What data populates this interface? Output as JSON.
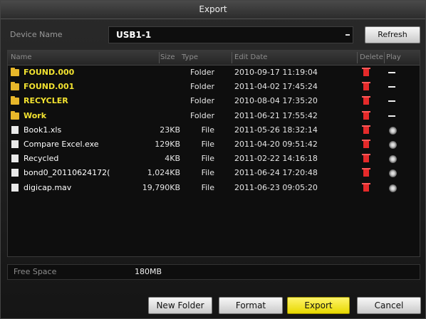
{
  "dialog": {
    "title": "Export"
  },
  "device": {
    "label": "Device Name",
    "value": "USB1-1",
    "refresh_label": "Refresh"
  },
  "table": {
    "headers": {
      "name": "Name",
      "size": "Size",
      "type": "Type",
      "edit_date": "Edit Date",
      "delete": "Delete",
      "play": "Play"
    },
    "rows": [
      {
        "name": "FOUND.000",
        "size": "",
        "type": "Folder",
        "date": "2010-09-17 11:19:04",
        "kind": "folder"
      },
      {
        "name": "FOUND.001",
        "size": "",
        "type": "Folder",
        "date": "2011-04-02 17:45:24",
        "kind": "folder"
      },
      {
        "name": "RECYCLER",
        "size": "",
        "type": "Folder",
        "date": "2010-08-04 17:35:20",
        "kind": "folder"
      },
      {
        "name": "Work",
        "size": "",
        "type": "Folder",
        "date": "2011-06-21 17:55:42",
        "kind": "folder"
      },
      {
        "name": "Book1.xls",
        "size": "23KB",
        "type": "File",
        "date": "2011-05-26 18:32:14",
        "kind": "file"
      },
      {
        "name": "Compare Excel.exe",
        "size": "129KB",
        "type": "File",
        "date": "2011-04-20 09:51:42",
        "kind": "file"
      },
      {
        "name": "Recycled",
        "size": "4KB",
        "type": "File",
        "date": "2011-02-22 14:16:18",
        "kind": "file"
      },
      {
        "name": "bond0_20110624172(",
        "size": "1,024KB",
        "type": "File",
        "date": "2011-06-24 17:20:48",
        "kind": "file"
      },
      {
        "name": "digicap.mav",
        "size": "19,790KB",
        "type": "File",
        "date": "2011-06-23 09:05:20",
        "kind": "file"
      }
    ]
  },
  "free_space": {
    "label": "Free Space",
    "value": "180MB"
  },
  "buttons": {
    "new_folder": "New Folder",
    "format": "Format",
    "export": "Export",
    "cancel": "Cancel"
  },
  "colors": {
    "folder_text": "#f2e230",
    "file_text": "#ffffff",
    "export_button": "#f2e400",
    "delete_icon": "#e52a2a"
  },
  "icons": {
    "folder": "folder-icon",
    "file": "file-icon",
    "delete": "trash-icon",
    "play": "play-icon",
    "no_play": "dash-icon"
  }
}
